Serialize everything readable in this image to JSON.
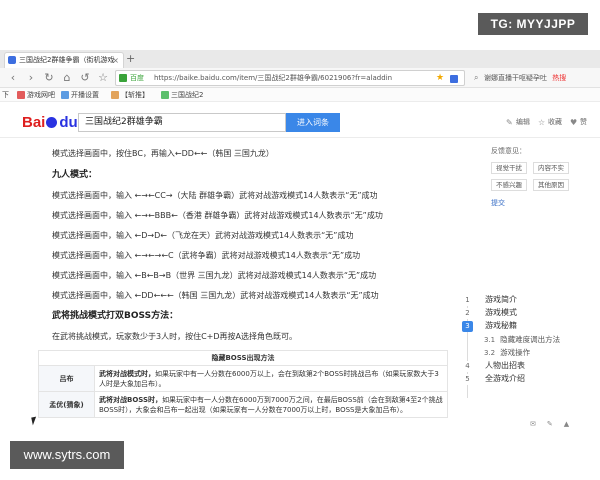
{
  "browser": {
    "tab_title": "三国战纪2群雄争霸（街机游戏",
    "new_tab": "+",
    "nav": {
      "back": "‹",
      "forward": "›",
      "reload": "↻",
      "home": "⌂",
      "undo": "↺",
      "bookmark": "☆"
    },
    "secure_label": "百度",
    "url": "https://baike.baidu.com/item/三国战纪2群雄争霸/6021906?fr=aladdin",
    "star": "★",
    "search_hint": "谢娜直播干呕疑孕吐",
    "hot_label": "热搜",
    "bookmarks": [
      {
        "label": "下",
        "color": "#888888"
      },
      {
        "label": "游戏网吧",
        "color": "#e25b5b"
      },
      {
        "label": "开播设置",
        "color": "#5b9be2"
      },
      {
        "label": "【斩推】",
        "color": "#e2a35b"
      },
      {
        "label": "三国战纪2",
        "color": "#5bbf6b"
      }
    ]
  },
  "baike": {
    "logo_text_1": "Bai",
    "logo_text_2": "du",
    "logo_text_3": "百科",
    "search_value": "三国战纪2群雄争霸",
    "enter_button": "进入词条",
    "header_links": [
      {
        "label": "编辑",
        "icon": "✎"
      },
      {
        "label": "收藏",
        "icon": "☆"
      },
      {
        "label": "赞",
        "icon": "👍"
      }
    ]
  },
  "article": {
    "lines": [
      {
        "type": "line",
        "text": "模式选择画面中，按住BC，再输入←DD←←（韩国 三国九龙）"
      },
      {
        "type": "heading",
        "text": "九人模式："
      },
      {
        "type": "line",
        "text": "模式选择画面中，输入 ←→←CC→（大陆 群雄争霸）武将对战游戏模式14人数表示“无”成功"
      },
      {
        "type": "line",
        "text": "模式选择画面中，输入 ←→←BBB←（香港 群雄争霸）武将对战游戏模式14人数表示“无”成功"
      },
      {
        "type": "line",
        "text": "模式选择画面中，输入 ←D→D←（飞龙在天）武将对战游戏模式14人数表示“无”成功"
      },
      {
        "type": "line",
        "text": "模式选择画面中，输入 ←→←→←C（武将争霸）武将对战游戏模式14人数表示“无”成功"
      },
      {
        "type": "line",
        "text": "模式选择画面中，输入 ←B←B→B（世界 三国九龙）武将对战游戏模式14人数表示“无”成功"
      },
      {
        "type": "line",
        "text": "模式选择画面中，输入 ←DD←←←（韩国 三国九龙）武将对战游戏模式14人数表示“无”成功"
      },
      {
        "type": "heading",
        "text": "武将挑战模式打双BOSS方法："
      },
      {
        "type": "line",
        "text": "在武将挑战模式，玩家数少于3人时，按住C+D再按A选择角色既可。"
      }
    ],
    "table": {
      "title": "隐藏BOSS出现方法",
      "rows": [
        {
          "name": "吕布",
          "lead": "武将对战模式时，",
          "text": "如果玩家中有一人分数在6000万以上，会在到敌第2个BOSS时挑战吕布（如果玩家数大于3人时是大象加吕布）。"
        },
        {
          "name": "孟优(猜象)",
          "lead": "武将对战BOSS时，",
          "text": "如果玩家中有一人分数在6000万到7000万之间，在最后BOSS前（会在到敌第4至2个挑战BOSS时），大象会和吕布一起出现（如果玩家有一人分数在7000万以上时，BOSS是大象加吕布）。"
        }
      ]
    }
  },
  "feedback": {
    "title": "反馈意见：",
    "options": [
      "视觉干扰",
      "内容不实",
      "不感兴趣",
      "其他原因"
    ],
    "submit": "提交"
  },
  "toc": {
    "items": [
      {
        "num": "1",
        "label": "游戏简介",
        "sub": false,
        "active": false
      },
      {
        "num": "2",
        "label": "游戏模式",
        "sub": false,
        "active": false
      },
      {
        "num": "3",
        "label": "游戏秘籍",
        "sub": false,
        "active": true
      },
      {
        "num": "3.1",
        "label": "隐藏难度调出方法",
        "sub": true,
        "active": false
      },
      {
        "num": "3.2",
        "label": "游戏操作",
        "sub": true,
        "active": false
      },
      {
        "num": "4",
        "label": "人物出招表",
        "sub": false,
        "active": false
      },
      {
        "num": "5",
        "label": "全游戏介绍",
        "sub": false,
        "active": false
      }
    ]
  },
  "watermarks": {
    "top": "TG: MYYJJPP",
    "bottom": "www.sytrs.com"
  }
}
